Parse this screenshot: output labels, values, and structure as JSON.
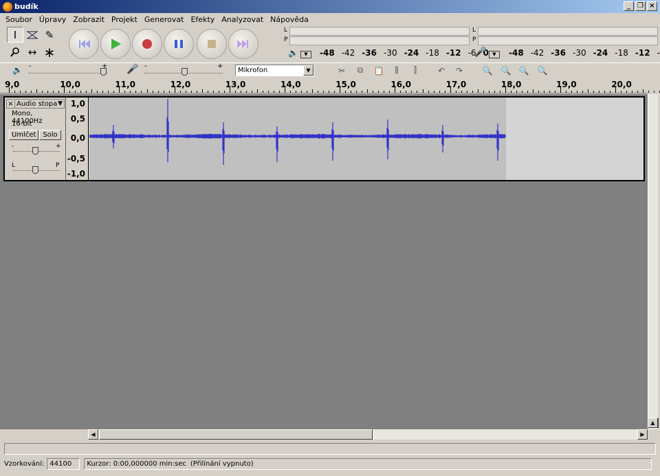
{
  "window": {
    "title": "budík"
  },
  "menu": [
    "Soubor",
    "Úpravy",
    "Zobrazit",
    "Projekt",
    "Generovat",
    "Efekty",
    "Analyzovat",
    "Nápověda"
  ],
  "meters": {
    "play_channel_top": "L",
    "play_channel_bottom": "P",
    "rec_channel_top": "L",
    "rec_channel_bottom": "P",
    "scale": [
      "-48",
      "-42",
      "-36",
      "-30",
      "-24",
      "-18",
      "-12",
      "-6",
      "0"
    ]
  },
  "mixer": {
    "output_slider": {
      "min_label": "-",
      "max_label": "+",
      "level": 1.0
    },
    "input_slider": {
      "min_label": "-",
      "max_label": "+",
      "level": 0.5
    },
    "input_source": "Mikrofon"
  },
  "ruler": {
    "ticks": [
      "9,0",
      "10,0",
      "11,0",
      "12,0",
      "13,0",
      "14,0",
      "15,0",
      "16,0",
      "17,0",
      "18,0",
      "19,0",
      "20,0"
    ]
  },
  "track": {
    "name": "Audio stopa",
    "format": "Mono, 44100Hz",
    "bitdepth": "16-bit",
    "mute_label": "Umlčet",
    "solo_label": "Solo",
    "gain_min": "-",
    "gain_max": "+",
    "pan_left": "L",
    "pan_right": "P",
    "scale": [
      "1,0",
      "0,5",
      "0,0",
      "-0,5",
      "-1,0"
    ]
  },
  "status": {
    "rate_label": "Vzorkování:",
    "rate_value": "44100",
    "cursor_text": "Kurzor: 0:00,000000 min:sec",
    "snap_text": "(Přilínání vypnuto)"
  },
  "colors": {
    "waveform": "#3232c8",
    "accent": "#0a246a"
  }
}
